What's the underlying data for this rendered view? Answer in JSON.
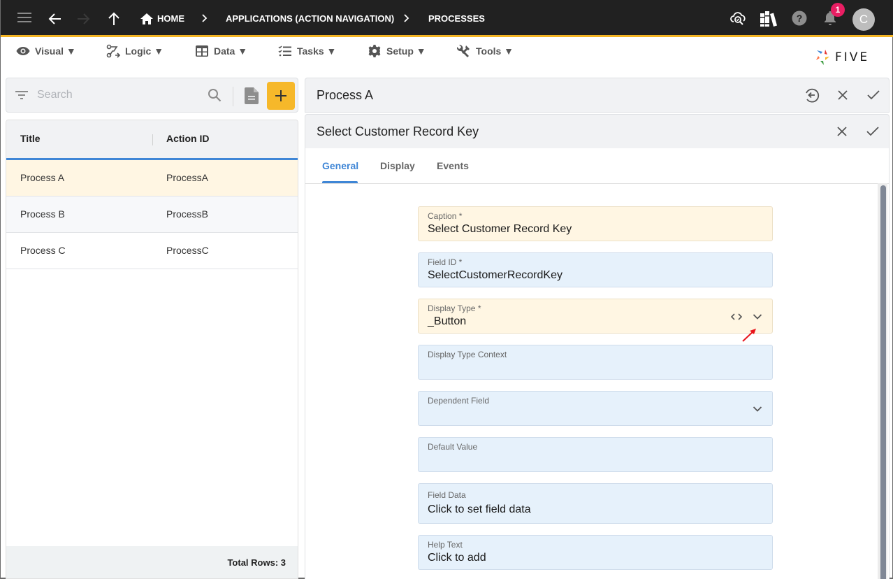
{
  "topbar": {
    "breadcrumbs": [
      {
        "label": "HOME",
        "icon": "home-icon"
      },
      {
        "label": "APPLICATIONS (ACTION NAVIGATION)"
      },
      {
        "label": "PROCESSES"
      }
    ],
    "icons": [
      "menu-icon",
      "back-arrow-icon",
      "forward-arrow-icon",
      "up-arrow-icon",
      "cloud-search-icon",
      "library-books-icon",
      "help-icon",
      "notifications-bell-icon"
    ],
    "notification_count": "1",
    "avatar_initial": "C"
  },
  "menubar": {
    "items": [
      {
        "label": "Visual ▼",
        "icon": "eye-icon"
      },
      {
        "label": "Logic ▼",
        "icon": "logic-flow-icon"
      },
      {
        "label": "Data ▼",
        "icon": "table-grid-icon"
      },
      {
        "label": "Tasks ▼",
        "icon": "checklist-icon"
      },
      {
        "label": "Setup ▼",
        "icon": "gear-icon"
      },
      {
        "label": "Tools ▼",
        "icon": "tools-icon"
      }
    ],
    "logo_text": "FIVE"
  },
  "left_panel": {
    "search": {
      "placeholder": "Search",
      "value": ""
    },
    "table": {
      "columns": [
        "Title",
        "Action ID"
      ],
      "rows": [
        {
          "title": "Process A",
          "action_id": "ProcessA",
          "selected": true
        },
        {
          "title": "Process B",
          "action_id": "ProcessB",
          "selected": false
        },
        {
          "title": "Process C",
          "action_id": "ProcessC",
          "selected": false
        }
      ],
      "footer": "Total Rows: 3"
    }
  },
  "record_panel": {
    "title": "Process A"
  },
  "field_panel": {
    "title": "Select Customer Record Key",
    "tabs": [
      {
        "label": "General",
        "active": true
      },
      {
        "label": "Display",
        "active": false
      },
      {
        "label": "Events",
        "active": false
      }
    ],
    "fields": [
      {
        "label": "Caption *",
        "value": "Select Customer Record Key",
        "style": "yellow"
      },
      {
        "label": "Field ID *",
        "value": "SelectCustomerRecordKey",
        "style": "blue"
      },
      {
        "label": "Display Type *",
        "value": "_Button",
        "style": "yellow"
      },
      {
        "label": "Display Type Context",
        "value": "",
        "style": "blue"
      },
      {
        "label": "Dependent Field",
        "value": "",
        "style": "blue"
      },
      {
        "label": "Default Value",
        "value": "",
        "style": "blue"
      },
      {
        "label": "Field Data",
        "value": "Click to set field data",
        "style": "blue"
      },
      {
        "label": "Help Text",
        "value": "Click to add",
        "style": "blue"
      }
    ]
  },
  "colors": {
    "topbar_bg": "#212121",
    "accent_yellow": "#f4b423",
    "accent_blue": "#3f86d6",
    "selected_row": "#fff6e3",
    "field_blue": "#e6f1fb",
    "badge": "#e91e63",
    "annotation_arrow": "#e8141b"
  }
}
